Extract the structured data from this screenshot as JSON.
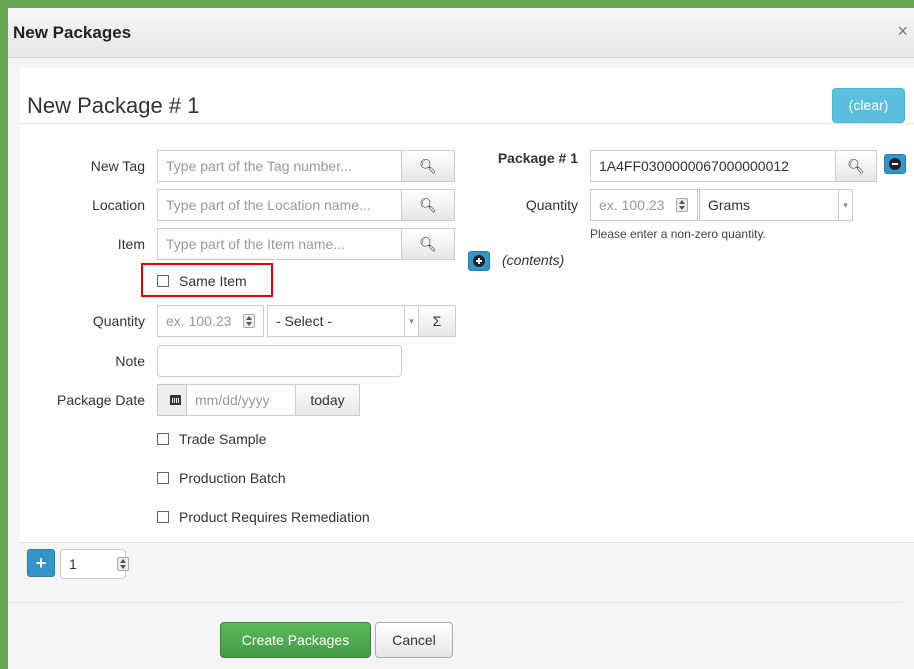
{
  "window": {
    "title": "New Packages",
    "close_label": "×"
  },
  "panel": {
    "title": "New Package # 1",
    "clear_label": "(clear)"
  },
  "left_form": {
    "new_tag": {
      "label": "New Tag",
      "placeholder": "Type part of the Tag number..."
    },
    "location": {
      "label": "Location",
      "placeholder": "Type part of the Location name..."
    },
    "item": {
      "label": "Item",
      "placeholder": "Type part of the Item name..."
    },
    "same_item": {
      "label": "Same Item"
    },
    "quantity": {
      "label": "Quantity",
      "placeholder": "ex. 100.23",
      "select_value": "- Select -",
      "sum_label": "Σ"
    },
    "note": {
      "label": "Note",
      "value": ""
    },
    "package_date": {
      "label": "Package Date",
      "placeholder": "mm/dd/yyyy",
      "today_label": "today"
    },
    "checkboxes": [
      "Trade Sample",
      "Production Batch",
      "Product Requires Remediation"
    ]
  },
  "right_form": {
    "package": {
      "label": "Package # 1",
      "value": "1A4FF0300000067000000012"
    },
    "quantity": {
      "label": "Quantity",
      "placeholder": "ex. 100.23",
      "unit": "Grams",
      "help": "Please enter a non-zero quantity."
    },
    "contents_label": "(contents)"
  },
  "footer": {
    "count_value": "1",
    "create_label": "Create Packages",
    "cancel_label": "Cancel"
  },
  "colors": {
    "accent_green": "#5cb85c",
    "info_blue": "#5bc0de",
    "highlight_red": "#e00000",
    "frame_green": "#6aa84f"
  }
}
